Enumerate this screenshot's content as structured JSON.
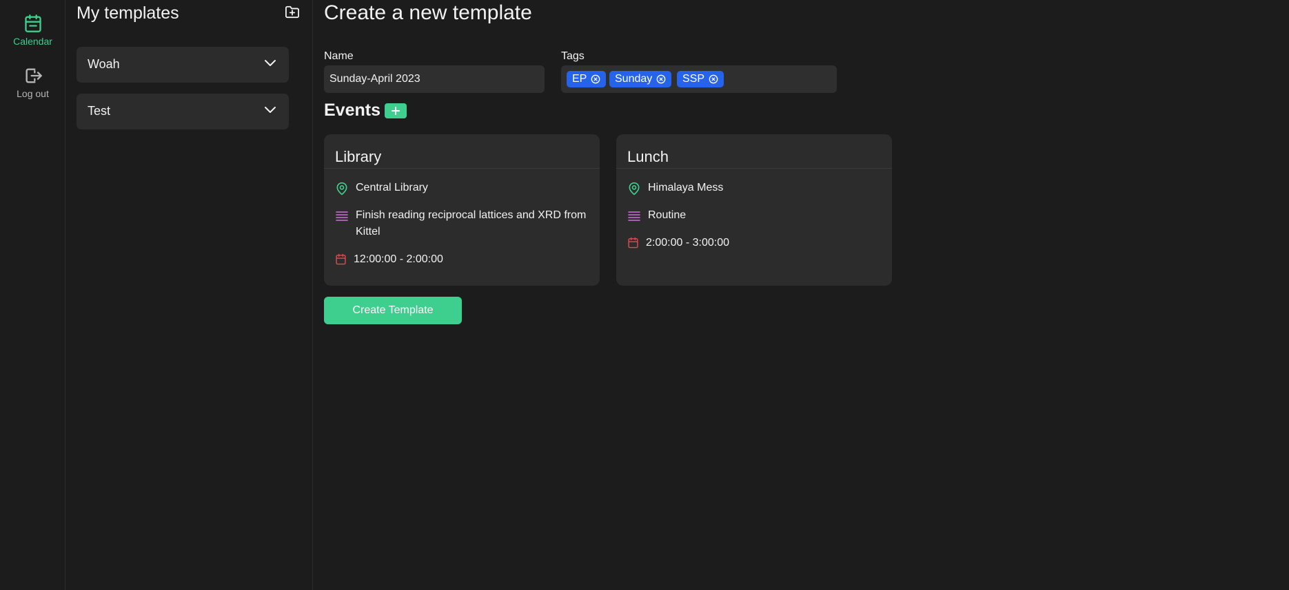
{
  "nav": {
    "calendar_label": "Calendar",
    "logout_label": "Log out"
  },
  "sidebar": {
    "title": "My templates",
    "templates": [
      {
        "label": "Woah"
      },
      {
        "label": "Test"
      }
    ]
  },
  "form": {
    "title": "Create a new template",
    "name_label": "Name",
    "name_value": "Sunday-April 2023",
    "tags_label": "Tags",
    "tags": [
      "EP",
      "Sunday",
      "SSP"
    ],
    "events_title": "Events",
    "submit_label": "Create Template"
  },
  "events": [
    {
      "title": "Library",
      "location": "Central Library",
      "description": "Finish reading reciprocal lattices and XRD from Kittel",
      "time": "12:00:00 - 2:00:00"
    },
    {
      "title": "Lunch",
      "location": "Himalaya Mess",
      "description": "Routine",
      "time": "2:00:00 - 3:00:00"
    }
  ],
  "colors": {
    "accent": "#3ecf8e",
    "tag": "#2563eb",
    "location_icon": "#3ecf8e",
    "description_icon": "#d36ee0",
    "time_icon": "#e5484d"
  }
}
